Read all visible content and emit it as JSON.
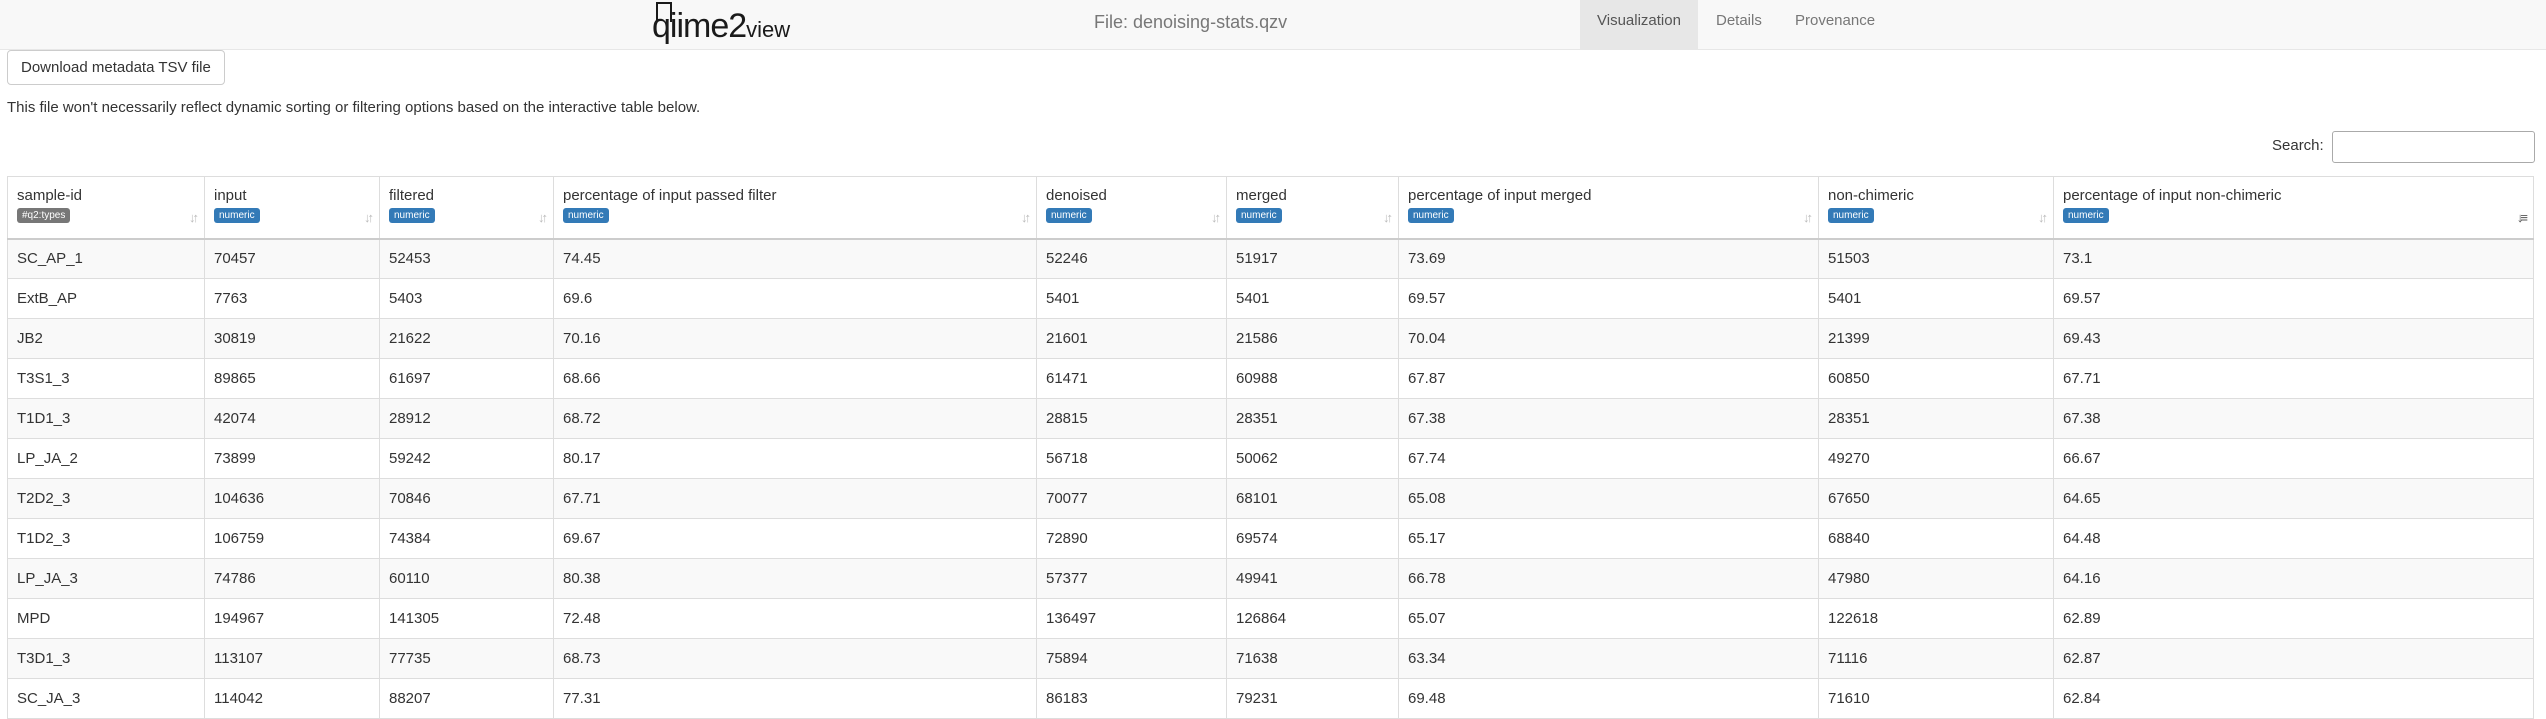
{
  "header": {
    "logo_text": "qiime2",
    "logo_sub": "view",
    "file_title": "File: denoising-stats.qzv",
    "tabs": [
      {
        "label": "Visualization",
        "active": true
      },
      {
        "label": "Details",
        "active": false
      },
      {
        "label": "Provenance",
        "active": false
      }
    ]
  },
  "download_button_label": "Download metadata TSV file",
  "note": "This file won't necessarily reflect dynamic sorting or filtering options based on the interactive table below.",
  "search": {
    "label": "Search:",
    "value": ""
  },
  "table": {
    "columns": [
      {
        "label": "sample-id",
        "type": "#q2:types"
      },
      {
        "label": "input",
        "type": "numeric"
      },
      {
        "label": "filtered",
        "type": "numeric"
      },
      {
        "label": "percentage of input passed filter",
        "type": "numeric"
      },
      {
        "label": "denoised",
        "type": "numeric"
      },
      {
        "label": "merged",
        "type": "numeric"
      },
      {
        "label": "percentage of input merged",
        "type": "numeric"
      },
      {
        "label": "non-chimeric",
        "type": "numeric"
      },
      {
        "label": "percentage of input non-chimeric",
        "type": "numeric"
      }
    ],
    "sorted_column": 8,
    "rows": [
      [
        "SC_AP_1",
        "70457",
        "52453",
        "74.45",
        "52246",
        "51917",
        "73.69",
        "51503",
        "73.1"
      ],
      [
        "ExtB_AP",
        "7763",
        "5403",
        "69.6",
        "5401",
        "5401",
        "69.57",
        "5401",
        "69.57"
      ],
      [
        "JB2",
        "30819",
        "21622",
        "70.16",
        "21601",
        "21586",
        "70.04",
        "21399",
        "69.43"
      ],
      [
        "T3S1_3",
        "89865",
        "61697",
        "68.66",
        "61471",
        "60988",
        "67.87",
        "60850",
        "67.71"
      ],
      [
        "T1D1_3",
        "42074",
        "28912",
        "68.72",
        "28815",
        "28351",
        "67.38",
        "28351",
        "67.38"
      ],
      [
        "LP_JA_2",
        "73899",
        "59242",
        "80.17",
        "56718",
        "50062",
        "67.74",
        "49270",
        "66.67"
      ],
      [
        "T2D2_3",
        "104636",
        "70846",
        "67.71",
        "70077",
        "68101",
        "65.08",
        "67650",
        "64.65"
      ],
      [
        "T1D2_3",
        "106759",
        "74384",
        "69.67",
        "72890",
        "69574",
        "65.17",
        "68840",
        "64.48"
      ],
      [
        "LP_JA_3",
        "74786",
        "60110",
        "80.38",
        "57377",
        "49941",
        "66.78",
        "47980",
        "64.16"
      ],
      [
        "MPD",
        "194967",
        "141305",
        "72.48",
        "136497",
        "126864",
        "65.07",
        "122618",
        "62.89"
      ],
      [
        "T3D1_3",
        "113107",
        "77735",
        "68.73",
        "75894",
        "71638",
        "63.34",
        "71116",
        "62.87"
      ],
      [
        "SC_JA_3",
        "114042",
        "88207",
        "77.31",
        "86183",
        "79231",
        "69.48",
        "71610",
        "62.84"
      ]
    ]
  }
}
